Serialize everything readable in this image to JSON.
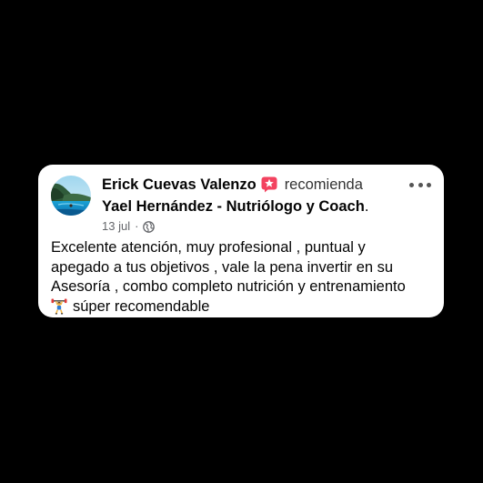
{
  "post": {
    "author": "Erick Cuevas Valenzo",
    "verb": "recomienda",
    "page_name": "Yael Hernández - Nutriólogo y Coach",
    "page_suffix": ".",
    "date": "13 jul",
    "separator": "·",
    "privacy_icon": "globe-icon",
    "recommend_icon": "recommend-star-icon",
    "body_lines": [
      "Excelente atención, muy profesional , puntual y",
      "apegado a tus objetivos , vale la pena invertir en su",
      "Asesoría , combo completo nutrición y entrenamiento"
    ],
    "emoji_icon": "weightlifter-emoji",
    "body_last_line": "súper recomendable"
  },
  "colors": {
    "background": "#000000",
    "card": "#ffffff",
    "text": "#050505",
    "meta": "#65676b",
    "recommend_badge": "#f3425f"
  }
}
